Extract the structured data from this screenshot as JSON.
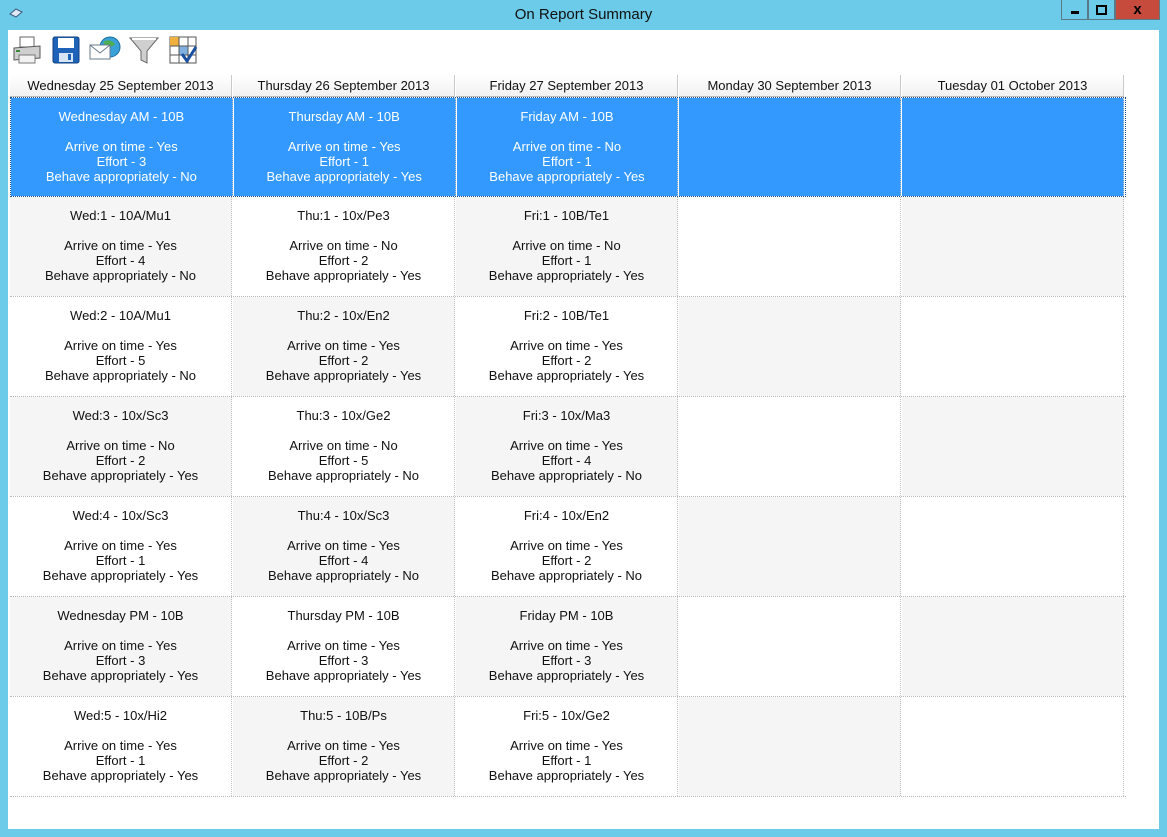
{
  "window": {
    "title": "On Report Summary",
    "close_glyph": "x"
  },
  "toolbar": {
    "icons": [
      "printer-icon",
      "save-icon",
      "email-icon",
      "filter-icon",
      "column-select-icon"
    ]
  },
  "columns": [
    "Wednesday 25 September 2013",
    "Thursday 26 September 2013",
    "Friday 27 September 2013",
    "Monday 30 September 2013",
    "Tuesday 01 October 2013"
  ],
  "rows": [
    {
      "selected": true,
      "cells": [
        {
          "title": "Wednesday AM - 10B",
          "arrive": "Arrive on time - Yes",
          "effort": "Effort - 3",
          "behave": "Behave appropriately - No"
        },
        {
          "title": "Thursday AM - 10B",
          "arrive": "Arrive on time - Yes",
          "effort": "Effort - 1",
          "behave": "Behave appropriately - Yes"
        },
        {
          "title": "Friday AM - 10B",
          "arrive": "Arrive on time - No",
          "effort": "Effort - 1",
          "behave": "Behave appropriately - Yes"
        },
        {},
        {}
      ]
    },
    {
      "cells": [
        {
          "title": "Wed:1 - 10A/Mu1",
          "arrive": "Arrive on time - Yes",
          "effort": "Effort - 4",
          "behave": "Behave appropriately - No"
        },
        {
          "title": "Thu:1 - 10x/Pe3",
          "arrive": "Arrive on time - No",
          "effort": "Effort - 2",
          "behave": "Behave appropriately - Yes"
        },
        {
          "title": "Fri:1 - 10B/Te1",
          "arrive": "Arrive on time - No",
          "effort": "Effort - 1",
          "behave": "Behave appropriately - Yes"
        },
        {},
        {}
      ]
    },
    {
      "cells": [
        {
          "title": "Wed:2 - 10A/Mu1",
          "arrive": "Arrive on time - Yes",
          "effort": "Effort - 5",
          "behave": "Behave appropriately - No"
        },
        {
          "title": "Thu:2 - 10x/En2",
          "arrive": "Arrive on time - Yes",
          "effort": "Effort - 2",
          "behave": "Behave appropriately - Yes"
        },
        {
          "title": "Fri:2 - 10B/Te1",
          "arrive": "Arrive on time - Yes",
          "effort": "Effort - 2",
          "behave": "Behave appropriately - Yes"
        },
        {},
        {}
      ]
    },
    {
      "cells": [
        {
          "title": "Wed:3 - 10x/Sc3",
          "arrive": "Arrive on time - No",
          "effort": "Effort - 2",
          "behave": "Behave appropriately - Yes"
        },
        {
          "title": "Thu:3 - 10x/Ge2",
          "arrive": "Arrive on time - No",
          "effort": "Effort - 5",
          "behave": "Behave appropriately - No"
        },
        {
          "title": "Fri:3 - 10x/Ma3",
          "arrive": "Arrive on time - Yes",
          "effort": "Effort - 4",
          "behave": "Behave appropriately - No"
        },
        {},
        {}
      ]
    },
    {
      "cells": [
        {
          "title": "Wed:4 - 10x/Sc3",
          "arrive": "Arrive on time - Yes",
          "effort": "Effort - 1",
          "behave": "Behave appropriately - Yes"
        },
        {
          "title": "Thu:4 - 10x/Sc3",
          "arrive": "Arrive on time - Yes",
          "effort": "Effort - 4",
          "behave": "Behave appropriately - No"
        },
        {
          "title": "Fri:4 - 10x/En2",
          "arrive": "Arrive on time - Yes",
          "effort": "Effort - 2",
          "behave": "Behave appropriately - No"
        },
        {},
        {}
      ]
    },
    {
      "cells": [
        {
          "title": "Wednesday PM - 10B",
          "arrive": "Arrive on time - Yes",
          "effort": "Effort - 3",
          "behave": "Behave appropriately - Yes"
        },
        {
          "title": "Thursday PM - 10B",
          "arrive": "Arrive on time - Yes",
          "effort": "Effort - 3",
          "behave": "Behave appropriately - Yes"
        },
        {
          "title": "Friday PM - 10B",
          "arrive": "Arrive on time - Yes",
          "effort": "Effort - 3",
          "behave": "Behave appropriately - Yes"
        },
        {},
        {}
      ]
    },
    {
      "cells": [
        {
          "title": "Wed:5 - 10x/Hi2",
          "arrive": "Arrive on time - Yes",
          "effort": "Effort - 1",
          "behave": "Behave appropriately - Yes"
        },
        {
          "title": "Thu:5 - 10B/Ps",
          "arrive": "Arrive on time - Yes",
          "effort": "Effort - 2",
          "behave": "Behave appropriately - Yes"
        },
        {
          "title": "Fri:5 - 10x/Ge2",
          "arrive": "Arrive on time - Yes",
          "effort": "Effort - 1",
          "behave": "Behave appropriately - Yes"
        },
        {},
        {}
      ]
    }
  ]
}
